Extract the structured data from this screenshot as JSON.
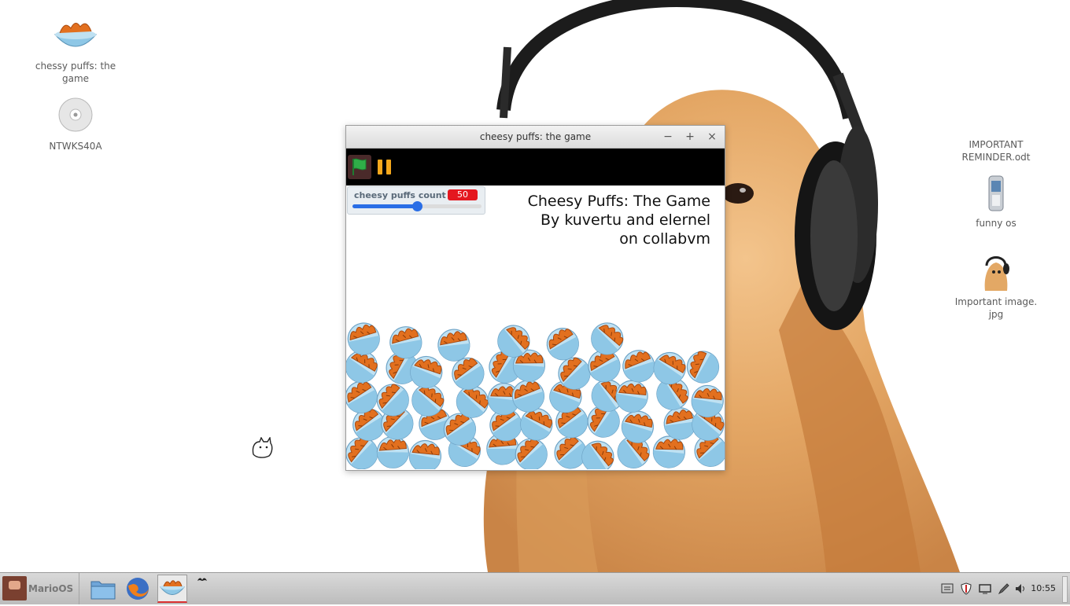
{
  "desktop": {
    "icons": [
      {
        "label": "chessy puffs: the game",
        "icon": "cheese-puffs-bowl-icon"
      },
      {
        "label": "NTWKS40A",
        "icon": "cd-disc-icon"
      },
      {
        "label": "IMPORTANT REMINDER.odt",
        "icon": "document-icon"
      },
      {
        "label": "funny os",
        "icon": "phone-icon"
      },
      {
        "label": "Important image. jpg",
        "icon": "image-thumbnail-icon"
      }
    ]
  },
  "window": {
    "title": "cheesy puffs: the game",
    "controls": {
      "minimize": "−",
      "maximize": "+",
      "close": "×"
    },
    "monitor": {
      "label": "cheesy puffs count",
      "value": "50",
      "slider_fraction": 0.5
    },
    "stage_text": [
      "Cheesy Puffs: The Game",
      "By kuvertu and elernel",
      "on collabvm"
    ],
    "bowl_count": 50
  },
  "taskbar": {
    "start_label": "MarioOS",
    "clock": "10:55",
    "tray": [
      "notes-icon",
      "shield-icon",
      "display-icon",
      "pen-icon",
      "volume-icon"
    ]
  },
  "colors": {
    "flag": "#2fae48",
    "pause": "#f5a81c",
    "counter": "#e4171f",
    "slider": "#2a6ee6"
  }
}
